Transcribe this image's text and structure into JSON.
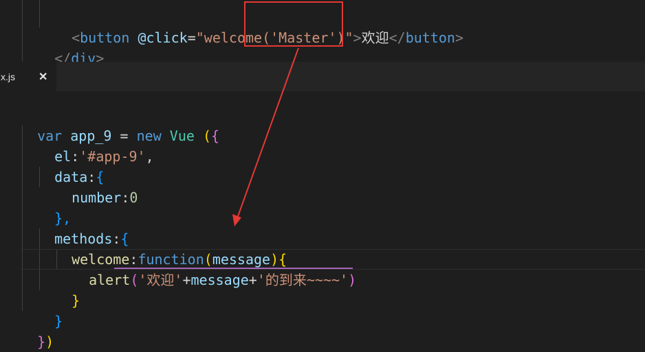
{
  "editor_top": {
    "line1": {
      "open_lt": "<",
      "tag": "button",
      "space": " ",
      "attr": "@click",
      "eq": "=",
      "value_quote_open": "\"",
      "value_fn": "welcome",
      "value_args": "('Master')",
      "value_quote_close": "\"",
      "gt": ">",
      "text": "欢迎",
      "close_lt": "</",
      "close_tag": "button",
      "close_gt": ">"
    },
    "line2": {
      "lt": "</",
      "tag": "div",
      "gt": ">"
    }
  },
  "tab": {
    "label": "x.js",
    "close": "✕"
  },
  "code": {
    "l1": {
      "var": "var",
      "name": " app_9 ",
      "eq": "= ",
      "new": "new",
      "cls": " Vue ",
      "paren": "(",
      "brace": "{"
    },
    "l2": {
      "key": "el",
      "colon": ":",
      "val": "'#app-9'",
      "comma": ","
    },
    "l3": {
      "key": "data",
      "colon": ":",
      "brace": "{"
    },
    "l4": {
      "key": "number",
      "colon": ":",
      "val": "0"
    },
    "l5": {
      "text": "},"
    },
    "l6": {
      "key": "methods",
      "colon": ":",
      "brace": "{"
    },
    "l7": {
      "key": "welcome",
      "colon": ":",
      "fn": "function",
      "paren_open": "(",
      "param": "message",
      "paren_close": ")",
      "brace": "{"
    },
    "l8": {
      "call": "alert",
      "paren_open": "(",
      "s1": "'欢迎'",
      "plus1": "+",
      "var": "message",
      "plus2": "+",
      "s2": "'的到来~~~~'",
      "paren_close": ")"
    },
    "l9": {
      "text": "}"
    },
    "l10": {
      "text": "}"
    },
    "l11": {
      "brace": "}",
      "paren": ")"
    }
  },
  "colors": {
    "background": "#1e1e1e",
    "annotation_red": "#e53935",
    "keyword": "#569cd6",
    "string": "#ce9178"
  }
}
